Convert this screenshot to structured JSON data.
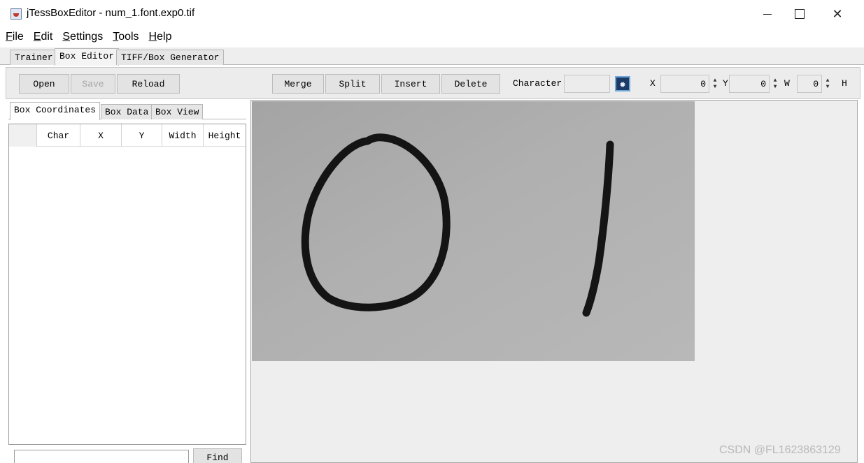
{
  "window": {
    "title": "jTessBoxEditor - num_1.font.exp0.tif",
    "minimize_symbol": "—",
    "maximize_symbol": "☐",
    "close_symbol": "✕"
  },
  "menu": {
    "items": [
      {
        "label_mnemonic": "F",
        "label_rest": "ile"
      },
      {
        "label_mnemonic": "E",
        "label_rest": "dit"
      },
      {
        "label_mnemonic": "S",
        "label_rest": "ettings"
      },
      {
        "label_mnemonic": "T",
        "label_rest": "ools"
      },
      {
        "label_mnemonic": "H",
        "label_rest": "elp"
      }
    ]
  },
  "top_tabs": [
    "Trainer",
    "Box Editor",
    "TIFF/Box Generator"
  ],
  "toolbar": {
    "open": "Open",
    "save": "Save",
    "reload": "Reload",
    "merge": "Merge",
    "split": "Split",
    "insert": "Insert",
    "delete": "Delete",
    "character_label": "Character",
    "character_value": "",
    "x_label": "X",
    "x_value": "0",
    "y_label": "Y",
    "y_value": "0",
    "w_label": "W",
    "w_value": "0",
    "h_label": "H"
  },
  "left_tabs": [
    "Box Coordinates",
    "Box Data",
    "Box View"
  ],
  "table": {
    "columns": [
      "",
      "Char",
      "X",
      "Y",
      "Width",
      "Height"
    ],
    "rows": []
  },
  "find": {
    "input_value": "",
    "button": "Find"
  },
  "image": {
    "digits_shown": [
      "0",
      "1"
    ]
  },
  "watermark": "CSDN @FL1623863129",
  "icons": {
    "app": "java-cup-icon",
    "character_font": "font-chooser-icon",
    "spinner": "spinner-arrows-icon"
  }
}
